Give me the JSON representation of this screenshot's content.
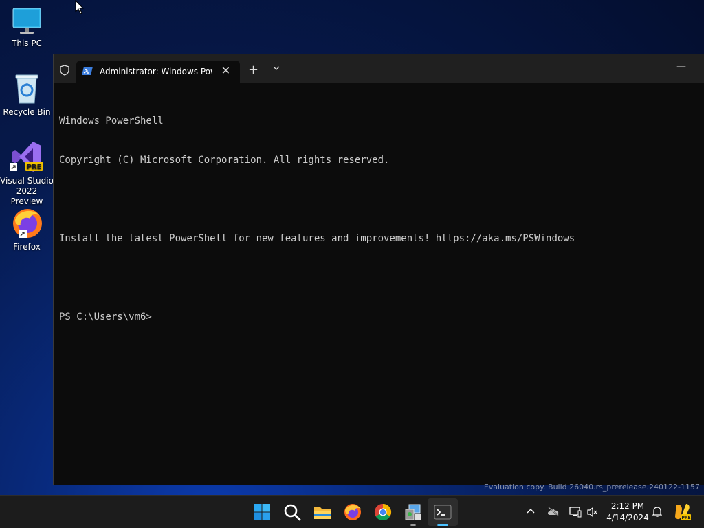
{
  "desktop": {
    "icons": [
      {
        "label": "This PC"
      },
      {
        "label": "Recycle Bin"
      },
      {
        "label_line1": "Visual Studio",
        "label_line2": "2022 Preview",
        "badge": "PRE"
      },
      {
        "label": "Firefox"
      }
    ]
  },
  "window": {
    "tab_title": "Administrator: Windows PowerShell",
    "tab_close": "✕",
    "new_tab": "+",
    "minimize": "—"
  },
  "console": {
    "lines": [
      "Windows PowerShell",
      "Copyright (C) Microsoft Corporation. All rights reserved.",
      "",
      "Install the latest PowerShell for new features and improvements! https://aka.ms/PSWindows",
      "",
      "PS C:\\Users\\vm6>"
    ]
  },
  "watermark": "Evaluation copy. Build 26040.rs_prerelease.240122-1157",
  "taskbar": {
    "time": "2:12 PM",
    "date": "4/14/2024",
    "copilot_badge": "PRE",
    "pinned": [
      "start-icon",
      "search-icon",
      "file-explorer-icon",
      "firefox-icon",
      "chrome-icon",
      "control-panel-icon",
      "terminal-icon"
    ]
  },
  "colors": {
    "console_bg": "#0c0c0c",
    "console_text": "#cccccc",
    "titlebar": "#202020",
    "taskbar": "#1c1c1c",
    "accent": "#4cc2ff"
  }
}
